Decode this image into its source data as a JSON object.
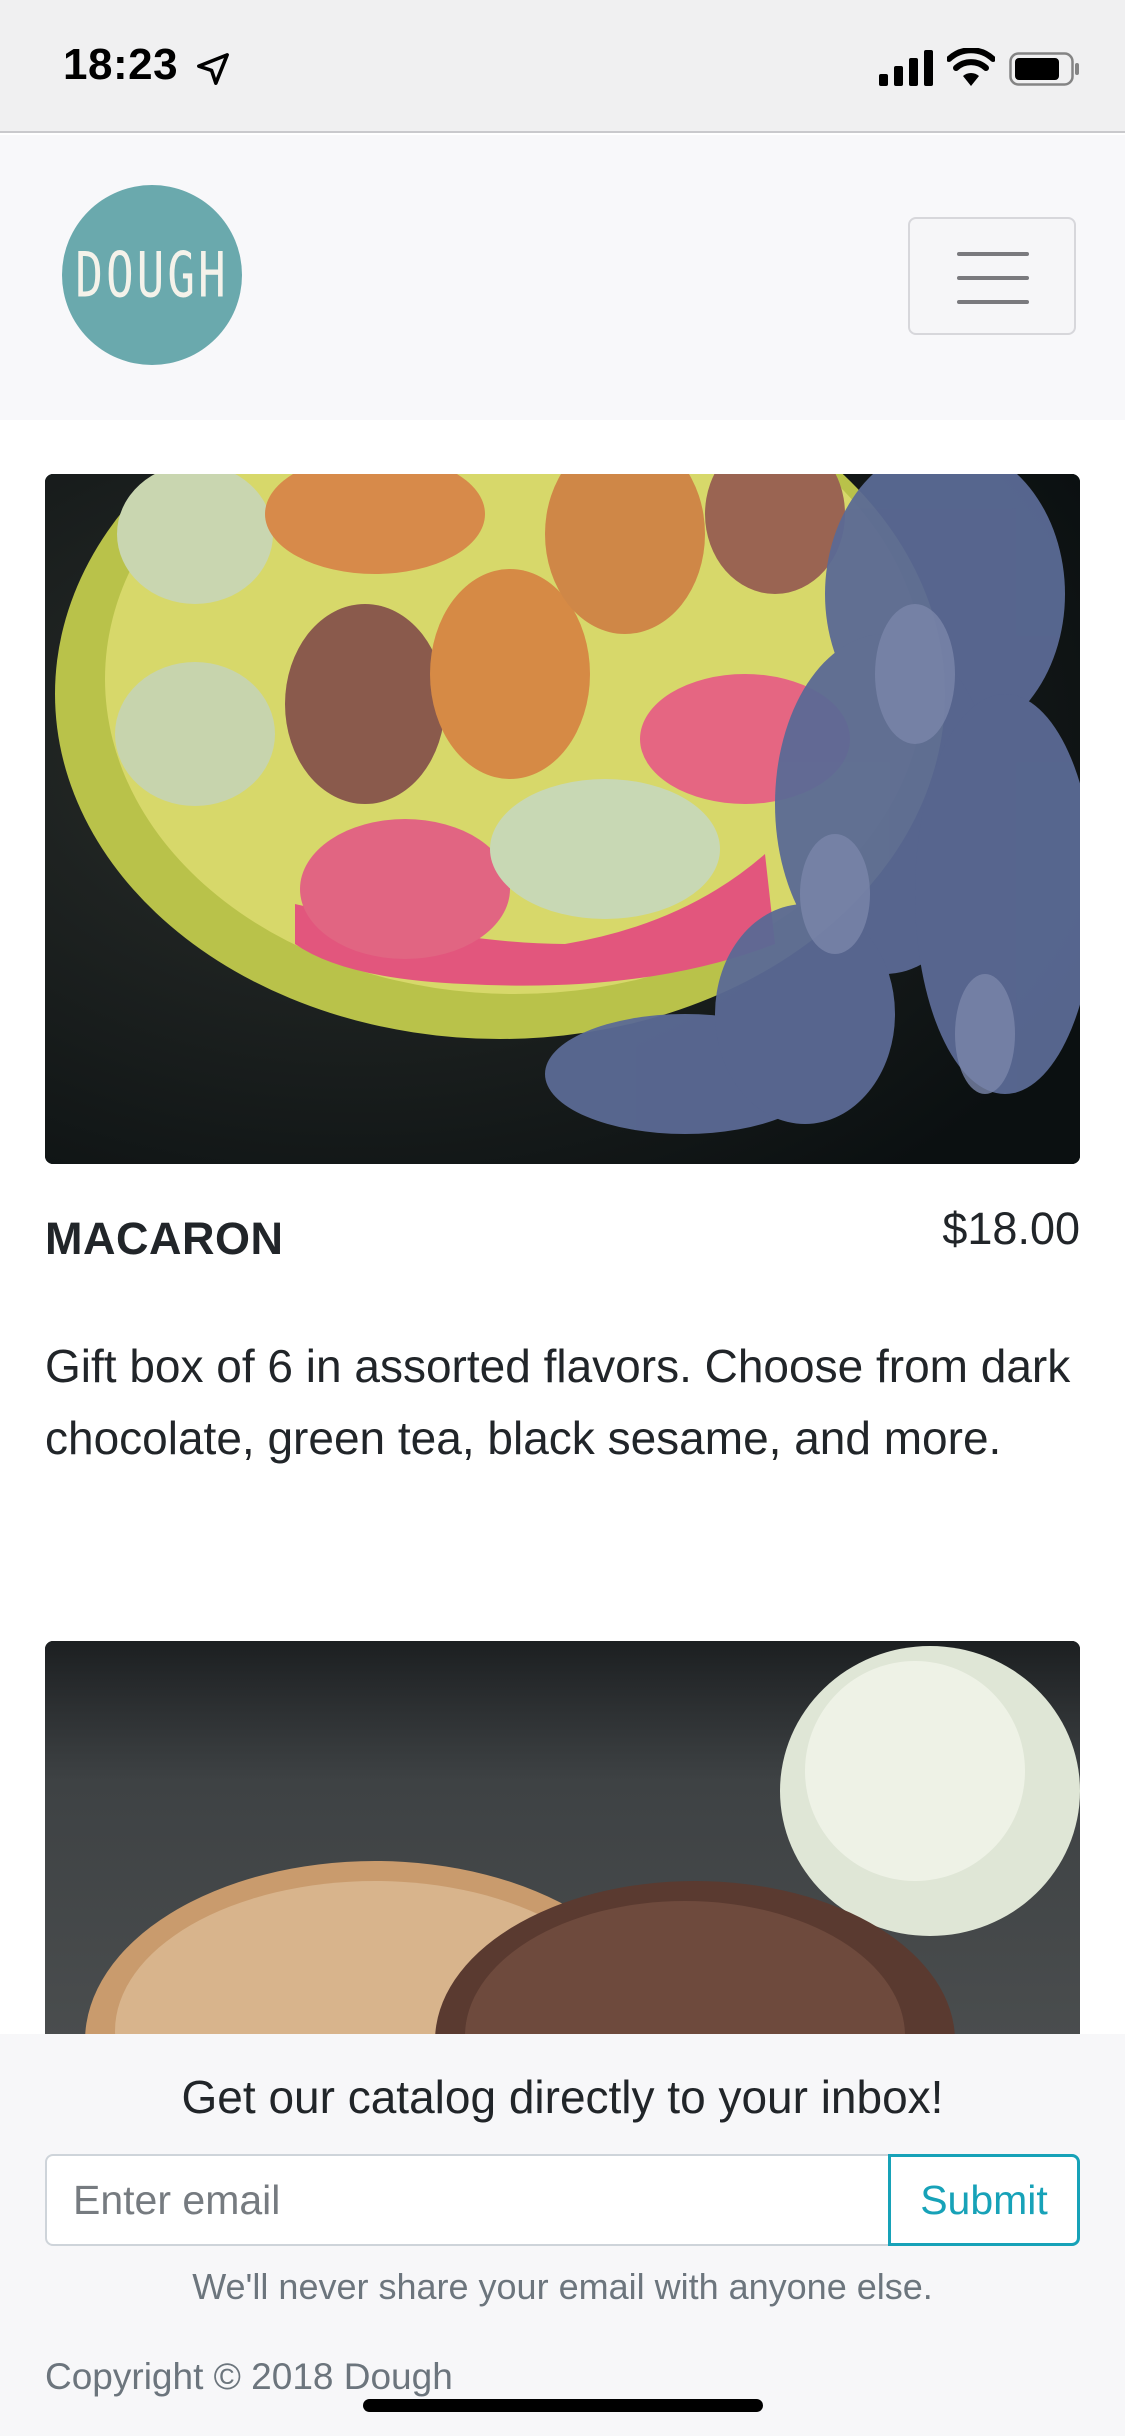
{
  "status_bar": {
    "time": "18:23",
    "icons": [
      "location-arrow-icon",
      "signal-bars-icon",
      "wifi-icon",
      "battery-icon"
    ]
  },
  "navbar": {
    "logo_text": "DOUGH",
    "menu_icon": "hamburger-menu-icon",
    "logo_color": "#6aa9ad"
  },
  "products": [
    {
      "name": "MACARON",
      "price": "$18.00",
      "description": "Gift box of 6 in assorted flavors. Choose from dark chocolate, green tea, black sesame, and more."
    }
  ],
  "footer": {
    "heading": "Get our catalog directly to your inbox!",
    "email_placeholder": "Enter email",
    "submit_label": "Submit",
    "help_text": "We'll never share your email with anyone else.",
    "copyright": "Copyright © 2018 Dough",
    "accent_color": "#17a2b8"
  }
}
